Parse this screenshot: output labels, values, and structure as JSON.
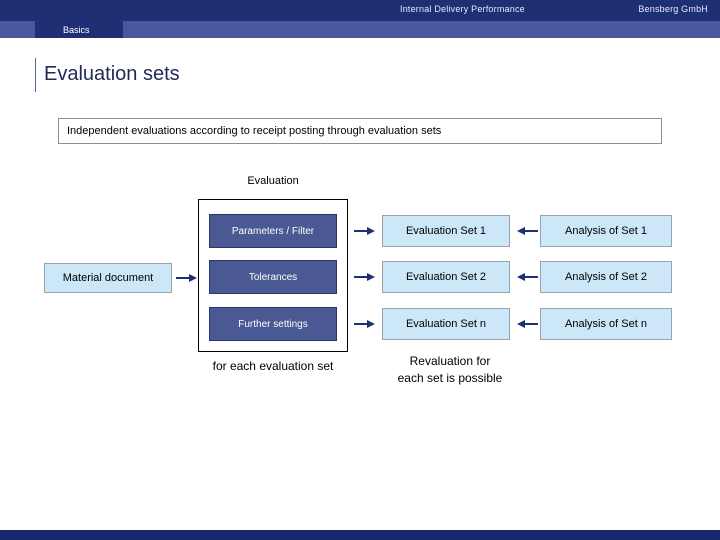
{
  "header": {
    "title": "Internal Delivery Performance",
    "company": "Bensberg GmbH",
    "tab_label": "Basics"
  },
  "page": {
    "title": "Evaluation sets",
    "subtitle": "Independent evaluations according to receipt posting through evaluation sets"
  },
  "diagram": {
    "group_label": "Evaluation",
    "input_box": "Material document",
    "settings": [
      "Parameters / Filter",
      "Tolerances",
      "Further settings"
    ],
    "evaluation_sets": [
      "Evaluation Set 1",
      "Evaluation Set 2",
      "Evaluation Set n"
    ],
    "analyses": [
      "Analysis of Set 1",
      "Analysis of Set 2",
      "Analysis of Set n"
    ],
    "caption_left": "for each evaluation set",
    "caption_right_line1": "Revaluation for",
    "caption_right_line2": "each set is possible"
  },
  "colors": {
    "header_dark": "#1f2f73",
    "tabbar": "#47589e",
    "dark_box": "#4a5894",
    "light_box": "#cbe7f8",
    "arrow": "#1f2f73",
    "footer": "#1a2570"
  }
}
